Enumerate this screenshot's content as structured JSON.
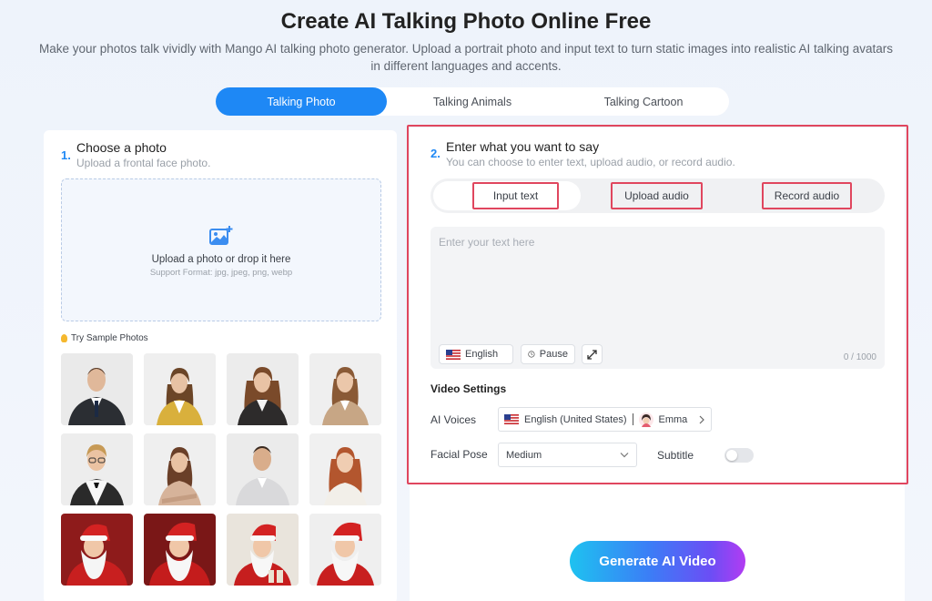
{
  "header": {
    "title": "Create AI Talking Photo Online Free",
    "subtitle": "Make your photos talk vividly with Mango AI talking photo generator. Upload a portrait photo and input text to turn static images into realistic AI talking avatars in different languages and accents."
  },
  "mode_tabs": [
    {
      "label": "Talking Photo",
      "active": true
    },
    {
      "label": "Talking Animals",
      "active": false
    },
    {
      "label": "Talking Cartoon",
      "active": false
    }
  ],
  "step1": {
    "number": "1.",
    "title": "Choose a photo",
    "description": "Upload a frontal face photo.",
    "upload_text": "Upload a photo or drop it here",
    "upload_formats": "Support Format: jpg, jpeg, png, webp",
    "samples_label": "Try Sample Photos"
  },
  "step2": {
    "number": "2.",
    "title": "Enter what you want to say",
    "description": "You can choose to enter text, upload audio, or record audio.",
    "source_tabs": [
      "Input text",
      "Upload audio",
      "Record audio"
    ],
    "text_placeholder": "Enter your text here",
    "language_chip": "English",
    "pause_chip": "Pause",
    "char_counter": "0 / 1000"
  },
  "video_settings": {
    "title": "Video Settings",
    "ai_voices_label": "AI Voices",
    "voice_language": "English (United States)",
    "voice_name": "Emma",
    "facial_pose_label": "Facial Pose",
    "facial_pose_value": "Medium",
    "subtitle_label": "Subtitle",
    "subtitle_enabled": false
  },
  "generate_button": "Generate AI Video",
  "colors": {
    "accent": "#1e88f5",
    "highlight": "#e0465e"
  }
}
